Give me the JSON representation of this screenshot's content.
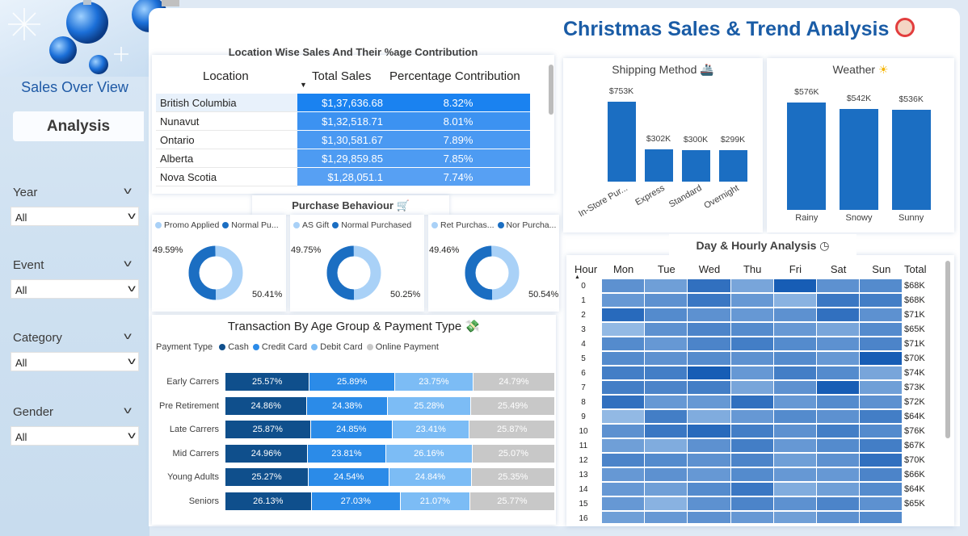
{
  "sidebar": {
    "nav_sales_overview": "Sales Over View",
    "nav_analysis": "Analysis",
    "slicers": [
      {
        "label": "Year",
        "value": "All"
      },
      {
        "label": "Event",
        "value": "All"
      },
      {
        "label": "Category",
        "value": "All"
      },
      {
        "label": "Gender",
        "value": "All"
      }
    ]
  },
  "header": {
    "title": "Christmas Sales & Trend Analysis"
  },
  "location_table": {
    "title": "Location Wise Sales And Their %age Contribution",
    "columns": [
      "Location",
      "Total Sales",
      "Percentage Contribution"
    ],
    "rows": [
      {
        "location": "British Columbia",
        "sales": "$1,37,636.68",
        "pct": "8.32%"
      },
      {
        "location": "Nunavut",
        "sales": "$1,32,518.71",
        "pct": "8.01%"
      },
      {
        "location": "Ontario",
        "sales": "$1,30,581.67",
        "pct": "7.89%"
      },
      {
        "location": "Alberta",
        "sales": "$1,29,859.85",
        "pct": "7.85%"
      },
      {
        "location": "Nova Scotia",
        "sales": "$1,28,051.1",
        "pct": "7.74%"
      }
    ]
  },
  "colors": {
    "dark": "#0f4f8c",
    "primary": "#1b6ec2",
    "mid": "#2b8be8",
    "light": "#7cbcf5",
    "pale": "#a9d1f7",
    "grey": "#c8c8c8"
  },
  "purchase_behaviour": {
    "title": "Purchase Behaviour"
  },
  "chart_data": [
    {
      "type": "pie",
      "labels": [
        "Promo Applied",
        "Normal Pu..."
      ],
      "values": [
        49.59,
        50.41
      ],
      "value_labels": [
        "49.59%",
        "50.41%"
      ]
    },
    {
      "type": "pie",
      "labels": [
        "AS Gift",
        "Normal Purchased"
      ],
      "values": [
        49.75,
        50.25
      ],
      "value_labels": [
        "49.75%",
        "50.25%"
      ]
    },
    {
      "type": "pie",
      "labels": [
        "Ret Purchas...",
        "Nor Purcha..."
      ],
      "values": [
        49.46,
        50.54
      ],
      "value_labels": [
        "49.46%",
        "50.54%"
      ]
    },
    {
      "type": "bar",
      "title": "Shipping Method",
      "categories": [
        "In-Store Pur...",
        "Express",
        "Standard",
        "Overnight"
      ],
      "values": [
        753,
        302,
        300,
        299
      ],
      "value_labels": [
        "$753K",
        "$302K",
        "$300K",
        "$299K"
      ]
    },
    {
      "type": "bar",
      "title": "Weather",
      "categories": [
        "Rainy",
        "Snowy",
        "Sunny"
      ],
      "values": [
        576,
        542,
        536
      ],
      "value_labels": [
        "$576K",
        "$542K",
        "$536K"
      ]
    },
    {
      "type": "bar",
      "title": "Transaction By Age Group & Payment Type",
      "legend_title": "Payment Type",
      "stacked": "100%",
      "categories": [
        "Early Carrers",
        "Pre Retirement",
        "Late Carrers",
        "Mid Carrers",
        "Young Adults",
        "Seniors"
      ],
      "series": [
        {
          "name": "Cash",
          "values": [
            25.57,
            24.86,
            25.87,
            24.96,
            25.27,
            26.13
          ]
        },
        {
          "name": "Credit Card",
          "values": [
            25.89,
            24.38,
            24.85,
            23.81,
            24.54,
            27.03
          ]
        },
        {
          "name": "Debit Card",
          "values": [
            23.75,
            25.28,
            23.41,
            26.16,
            24.84,
            21.07
          ]
        },
        {
          "name": "Online Payment",
          "values": [
            24.79,
            25.49,
            25.87,
            25.07,
            25.35,
            25.77
          ]
        }
      ]
    },
    {
      "type": "heatmap",
      "title": "Day & Hourly Analysis",
      "row_header": "Hour",
      "total_header": "Total",
      "columns": [
        "Mon",
        "Tue",
        "Wed",
        "Thu",
        "Fri",
        "Sat",
        "Sun"
      ],
      "rows": [
        "0",
        "1",
        "2",
        "3",
        "4",
        "5",
        "6",
        "7",
        "8",
        "9",
        "10",
        "11",
        "12",
        "13",
        "14",
        "15",
        "16"
      ],
      "totals": [
        "$68K",
        "$68K",
        "$71K",
        "$65K",
        "$71K",
        "$70K",
        "$74K",
        "$73K",
        "$72K",
        "$64K",
        "$76K",
        "$67K",
        "$70K",
        "$66K",
        "$64K",
        "$65K",
        ""
      ],
      "intensity": [
        [
          0.55,
          0.45,
          0.8,
          0.4,
          0.95,
          0.55,
          0.6
        ],
        [
          0.5,
          0.55,
          0.75,
          0.5,
          0.3,
          0.75,
          0.7
        ],
        [
          0.85,
          0.6,
          0.55,
          0.5,
          0.55,
          0.8,
          0.55
        ],
        [
          0.25,
          0.55,
          0.65,
          0.6,
          0.5,
          0.4,
          0.6
        ],
        [
          0.6,
          0.5,
          0.65,
          0.7,
          0.6,
          0.55,
          0.65
        ],
        [
          0.6,
          0.55,
          0.6,
          0.55,
          0.6,
          0.5,
          0.95
        ],
        [
          0.7,
          0.7,
          0.95,
          0.5,
          0.7,
          0.6,
          0.4
        ],
        [
          0.7,
          0.65,
          0.7,
          0.4,
          0.55,
          0.95,
          0.45
        ],
        [
          0.8,
          0.5,
          0.5,
          0.8,
          0.5,
          0.6,
          0.55
        ],
        [
          0.25,
          0.7,
          0.35,
          0.5,
          0.6,
          0.55,
          0.7
        ],
        [
          0.55,
          0.75,
          0.85,
          0.7,
          0.55,
          0.7,
          0.6
        ],
        [
          0.45,
          0.35,
          0.55,
          0.7,
          0.5,
          0.6,
          0.7
        ],
        [
          0.65,
          0.6,
          0.55,
          0.65,
          0.45,
          0.55,
          0.8
        ],
        [
          0.5,
          0.55,
          0.5,
          0.6,
          0.5,
          0.5,
          0.65
        ],
        [
          0.5,
          0.45,
          0.6,
          0.75,
          0.35,
          0.45,
          0.6
        ],
        [
          0.5,
          0.3,
          0.55,
          0.65,
          0.55,
          0.65,
          0.55
        ],
        [
          0.45,
          0.5,
          0.55,
          0.5,
          0.45,
          0.55,
          0.6
        ]
      ]
    }
  ]
}
